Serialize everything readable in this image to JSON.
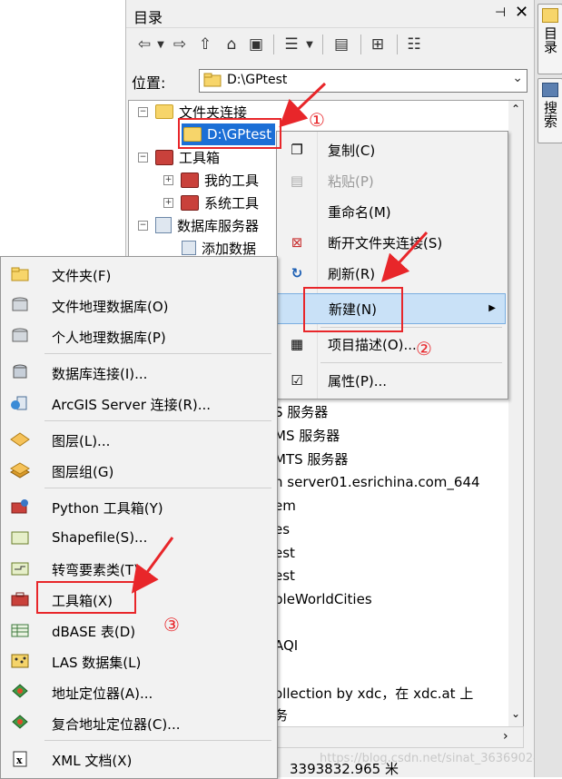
{
  "catalog": {
    "title": "目录",
    "pin_glyph": "⊣",
    "close_glyph": "✕",
    "location_label": "位置:",
    "location_value": "D:\\GPtest"
  },
  "tree": {
    "items": [
      {
        "label": "文件夹连接",
        "expander": "−"
      },
      {
        "label": "D:\\GPtest"
      },
      {
        "label": "工具箱",
        "expander": "−"
      },
      {
        "label": "我的工具",
        "expander": "+"
      },
      {
        "label": "系统工具",
        "expander": "+"
      },
      {
        "label": "数据库服务器",
        "expander": "−"
      },
      {
        "label": "添加数据"
      }
    ],
    "partial_rows": [
      "S 服务器",
      "MS 服务器",
      "MTS 服务器",
      "n server01.esrichina.com_644",
      "em",
      "es",
      "est",
      "est",
      "pleWorldCities",
      "",
      "AQI",
      "",
      "ollection by xdc，在 xdc.at 上",
      "务"
    ]
  },
  "status_text": "3393832.965 米",
  "watermark": "https://blog.csdn.net/sinat_36369024",
  "side_tabs": [
    "目录",
    "搜索"
  ],
  "context_menu": {
    "items": [
      {
        "label": "复制(C)",
        "icon": "copy-icon",
        "disabled": false
      },
      {
        "label": "粘贴(P)",
        "icon": "paste-icon",
        "disabled": true
      },
      {
        "label": "重命名(M)",
        "icon": "",
        "disabled": false
      },
      {
        "label": "断开文件夹连接(S)",
        "icon": "disconnect-folder-icon",
        "disabled": false
      },
      {
        "label": "刷新(R)",
        "icon": "refresh-icon",
        "disabled": false
      },
      {
        "label": "新建(N)",
        "icon": "",
        "disabled": false,
        "submenu_arrow": "▶"
      },
      {
        "label": "项目描述(O)...",
        "icon": "item-description-icon",
        "disabled": false
      },
      {
        "label": "属性(P)...",
        "icon": "properties-icon",
        "disabled": false
      }
    ]
  },
  "new_submenu": {
    "items": [
      {
        "label": "文件夹(F)",
        "icon": "folder-icon"
      },
      {
        "label": "文件地理数据库(O)",
        "icon": "file-geodatabase-icon"
      },
      {
        "label": "个人地理数据库(P)",
        "icon": "personal-geodatabase-icon"
      },
      {
        "label": "数据库连接(I)...",
        "icon": "database-connection-icon"
      },
      {
        "label": "ArcGIS Server 连接(R)...",
        "icon": "arcgis-server-icon"
      },
      {
        "label": "图层(L)...",
        "icon": "layer-icon"
      },
      {
        "label": "图层组(G)",
        "icon": "layer-group-icon"
      },
      {
        "label": "Python 工具箱(Y)",
        "icon": "python-toolbox-icon"
      },
      {
        "label": "Shapefile(S)...",
        "icon": "shapefile-icon"
      },
      {
        "label": "转弯要素类(T)...",
        "icon": "turn-feature-class-icon"
      },
      {
        "label": "工具箱(X)",
        "icon": "toolbox-icon"
      },
      {
        "label": "dBASE 表(D)",
        "icon": "dbase-table-icon"
      },
      {
        "label": "LAS 数据集(L)",
        "icon": "las-dataset-icon"
      },
      {
        "label": "地址定位器(A)...",
        "icon": "address-locator-icon"
      },
      {
        "label": "复合地址定位器(C)...",
        "icon": "composite-locator-icon"
      },
      {
        "label": "XML 文档(X)",
        "icon": "xml-document-icon"
      }
    ]
  },
  "annotations": {
    "step1": "①",
    "step2": "②",
    "step3": "③",
    "color": "#e8262a"
  }
}
